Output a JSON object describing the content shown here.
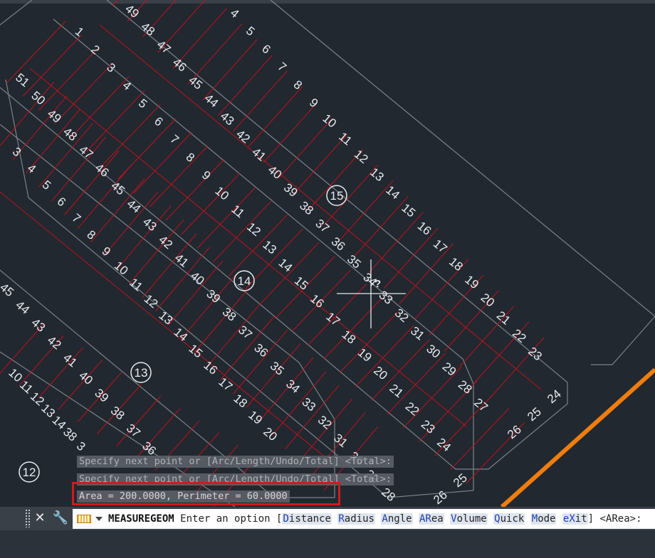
{
  "colors": {
    "background": "#212830",
    "lot_lines": "#c1121b",
    "block_outline": "#7c8288",
    "text": "#e9ecef",
    "road_line": "#f07d0c",
    "highlight": "#d01b1b"
  },
  "blocks": [
    {
      "label": "12"
    },
    {
      "label": "13"
    },
    {
      "label": "14"
    },
    {
      "label": "15"
    }
  ],
  "lot_numbers": {
    "block15_top": [
      "49",
      "48",
      "47",
      "46",
      "45",
      "44",
      "43",
      "42",
      "41",
      "40",
      "39",
      "38",
      "37",
      "36",
      "35",
      "34",
      "33",
      "32",
      "31",
      "30",
      "29",
      "28",
      "27"
    ],
    "block15_bottom": [
      "4",
      "5",
      "6",
      "7",
      "8",
      "9",
      "10",
      "11",
      "12",
      "13",
      "14",
      "15",
      "16",
      "17",
      "18",
      "19",
      "20",
      "21",
      "22",
      "23"
    ],
    "block15_end": [
      "24",
      "25",
      "26"
    ],
    "block14_top": [
      "51",
      "50",
      "49",
      "48",
      "47",
      "46",
      "45",
      "44",
      "43",
      "42",
      "41",
      "40",
      "39",
      "38",
      "37",
      "36",
      "35",
      "34",
      "33",
      "32",
      "31",
      "30",
      "29",
      "28"
    ],
    "block14_bottom": [
      "1",
      "2",
      "3",
      "4",
      "5",
      "6",
      "7",
      "8",
      "9",
      "10",
      "11",
      "12",
      "13",
      "14",
      "15",
      "16",
      "17",
      "18",
      "19",
      "20",
      "21",
      "22",
      "23",
      "24"
    ],
    "block14_end": [
      "25",
      "26"
    ],
    "block13_top": [
      "45",
      "44",
      "43",
      "42",
      "41",
      "40",
      "39",
      "38",
      "37",
      "36"
    ],
    "block13_bottom": [
      "3",
      "4",
      "5",
      "6",
      "7",
      "8",
      "9",
      "10",
      "11",
      "12",
      "13",
      "14",
      "15",
      "16",
      "17",
      "18",
      "19",
      "20"
    ],
    "block12": [
      "10",
      "11",
      "12",
      "13",
      "14",
      "38",
      "3"
    ]
  },
  "cursor": {
    "glyph": "?"
  },
  "history": [
    "Specify next point or [Arc/Length/Undo/Total] <Total>:",
    "Specify next point or [Arc/Length/Undo/Total] <Total>:",
    "Area = 200.0000, Perimeter = 60.0000"
  ],
  "command": {
    "close_icon": "close-icon",
    "customize_icon": "wrench-icon",
    "name": "MEASUREGEOM",
    "prompt": "Enter an option [",
    "options": [
      {
        "key": "D",
        "rest": "istance"
      },
      {
        "key": "R",
        "rest": "adius"
      },
      {
        "key": "A",
        "rest": "ngle"
      },
      {
        "key": "AR",
        "rest": "ea"
      },
      {
        "key": "V",
        "rest": "olume"
      },
      {
        "key": "Q",
        "rest": "uick"
      },
      {
        "key": "M",
        "rest": "ode"
      },
      {
        "key": "eX",
        "rest": "it"
      }
    ],
    "suffix": "] <ARea>:"
  }
}
